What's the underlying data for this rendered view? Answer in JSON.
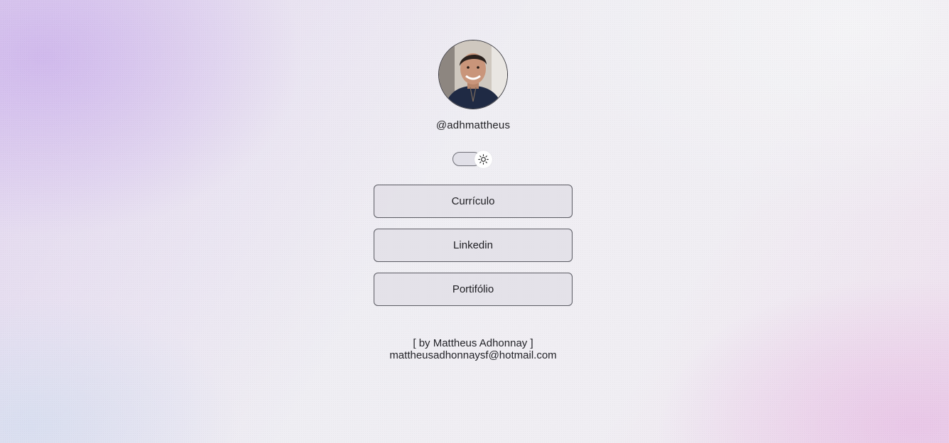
{
  "profile": {
    "handle": "@adhmattheus"
  },
  "theme_toggle": {
    "icon": "sun-icon",
    "state": "light"
  },
  "links": [
    {
      "label": "Currículo"
    },
    {
      "label": "Linkedin"
    },
    {
      "label": "Portifólio"
    }
  ],
  "footer": {
    "by": "[ by Mattheus Adhonnay ]",
    "email": "mattheusadhonnaysf@hotmail.com"
  },
  "colors": {
    "accent_purple": "#cdb4ec",
    "accent_pink": "#e8c4e6",
    "button_bg": "#e0dee6",
    "text": "#1f1f24"
  }
}
